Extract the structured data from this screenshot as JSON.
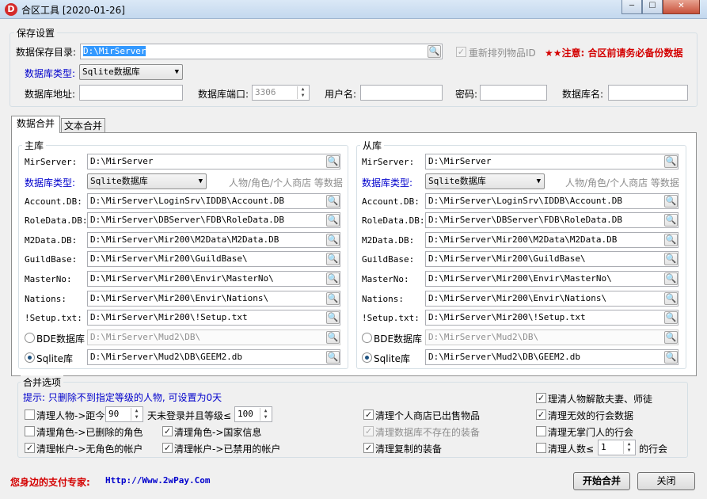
{
  "window": {
    "title": "合区工具 [2020-01-26]",
    "icon_letter": "D",
    "minimize": "─",
    "maximize": "☐",
    "close": "✕"
  },
  "save_settings": {
    "group_title": "保存设置",
    "dir_label": "数据保存目录:",
    "dir_value": "D:\\MirServer",
    "reorder_label": "重新排列物品ID",
    "reorder_checked": true,
    "notice": "★★注意: 合区前请务必备份数据",
    "db_type_label": "数据库类型:",
    "db_type_value": "Sqlite数据库",
    "db_addr_label": "数据库地址:",
    "db_addr_value": "",
    "db_port_label": "数据库端口:",
    "db_port_value": "3306",
    "user_label": "用户名:",
    "user_value": "",
    "password_label": "密码:",
    "password_value": "",
    "db_name_label": "数据库名:",
    "db_name_value": ""
  },
  "tabs": [
    {
      "label": "数据合并",
      "active": true
    },
    {
      "label": "文本合并",
      "active": false
    }
  ],
  "main_db": {
    "group_title": "主库",
    "mirserver_label": "MirServer:",
    "mirserver_value": "D:\\MirServer",
    "db_type_label": "数据库类型:",
    "db_type_value": "Sqlite数据库",
    "hint": "人物/角色/个人商店 等数据",
    "rows": [
      {
        "label": "Account.DB:",
        "value": "D:\\MirServer\\LoginSrv\\IDDB\\Account.DB"
      },
      {
        "label": "RoleData.DB:",
        "value": "D:\\MirServer\\DBServer\\FDB\\RoleData.DB"
      },
      {
        "label": "M2Data.DB:",
        "value": "D:\\MirServer\\Mir200\\M2Data\\M2Data.DB"
      },
      {
        "label": "GuildBase:",
        "value": "D:\\MirServer\\Mir200\\GuildBase\\"
      },
      {
        "label": "MasterNo:",
        "value": "D:\\MirServer\\Mir200\\Envir\\MasterNo\\"
      },
      {
        "label": "Nations:",
        "value": "D:\\MirServer\\Mir200\\Envir\\Nations\\"
      },
      {
        "label": "!Setup.txt:",
        "value": "D:\\MirServer\\Mir200\\!Setup.txt"
      }
    ],
    "bde_label": "BDE数据库",
    "bde_value": "D:\\MirServer\\Mud2\\DB\\",
    "sqlite_label": "Sqlite库",
    "sqlite_value": "D:\\MirServer\\Mud2\\DB\\GEEM2.db"
  },
  "sub_db": {
    "group_title": "从库",
    "mirserver_label": "MirServer:",
    "mirserver_value": "D:\\MirServer",
    "db_type_label": "数据库类型:",
    "db_type_value": "Sqlite数据库",
    "hint": "人物/角色/个人商店 等数据",
    "rows": [
      {
        "label": "Account.DB:",
        "value": "D:\\MirServer\\LoginSrv\\IDDB\\Account.DB"
      },
      {
        "label": "RoleData.DB:",
        "value": "D:\\MirServer\\DBServer\\FDB\\RoleData.DB"
      },
      {
        "label": "M2Data.DB:",
        "value": "D:\\MirServer\\Mir200\\M2Data\\M2Data.DB"
      },
      {
        "label": "GuildBase:",
        "value": "D:\\MirServer\\Mir200\\GuildBase\\"
      },
      {
        "label": "MasterNo:",
        "value": "D:\\MirServer\\Mir200\\Envir\\MasterNo\\"
      },
      {
        "label": "Nations:",
        "value": "D:\\MirServer\\Mir200\\Envir\\Nations\\"
      },
      {
        "label": "!Setup.txt:",
        "value": "D:\\MirServer\\Mir200\\!Setup.txt"
      }
    ],
    "bde_label": "BDE数据库",
    "bde_value": "D:\\MirServer\\Mud2\\DB\\",
    "sqlite_label": "Sqlite库",
    "sqlite_value": "D:\\MirServer\\Mud2\\DB\\GEEM2.db"
  },
  "merge_options": {
    "group_title": "合并选项",
    "tip": "提示: 只删除不到指定等级的人物, 可设置为0天",
    "clear_char_label1": "清理人物->距今",
    "days_value": "90",
    "clear_char_label2": "天未登录并且等级≤",
    "level_value": "100",
    "clear_deleted_role": "清理角色->已删除的角色",
    "clear_nation": "清理角色->国家信息",
    "clear_no_role_account": "清理帐户->无角色的帐户",
    "clear_banned_account": "清理帐户->已禁用的帐户",
    "clear_shop_sold": "清理个人商店已出售物品",
    "clear_missing_equip": "清理数据库不存在的装备",
    "clear_duplicate_equip": "清理复制的装备",
    "dissolve_couple": "理清人物解散夫妻、师徒",
    "clear_invalid_guild": "清理无效的行会数据",
    "clear_leaderless_guild": "清理无掌门人的行会",
    "clear_count_label1": "清理人数≤",
    "count_value": "1",
    "clear_count_label2": "的行会"
  },
  "footer": {
    "slogan_label": "您身边的支付专家:",
    "slogan_url": "Http://Www.2wPay.Com",
    "start_button": "开始合并",
    "close_button": "关闭"
  },
  "icons": {
    "browse": "🔍",
    "check": "✓",
    "dropdown": "▼",
    "up": "▲",
    "down": "▼"
  }
}
